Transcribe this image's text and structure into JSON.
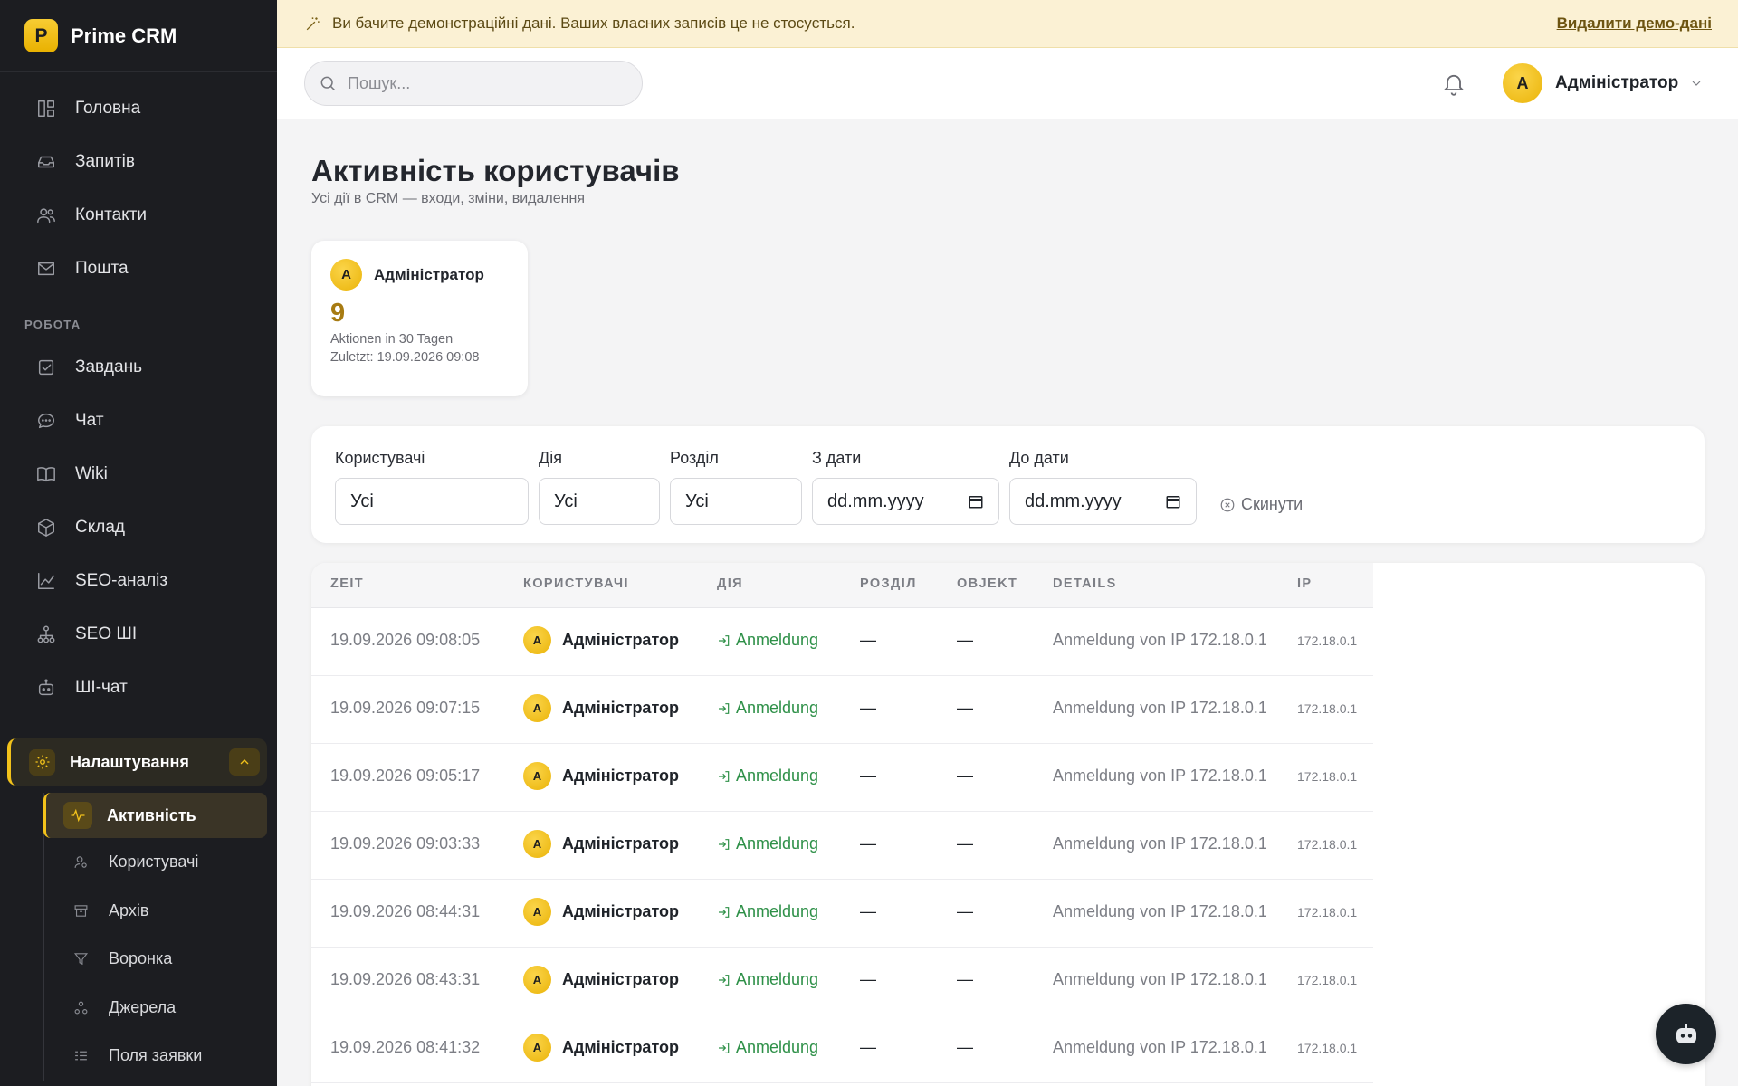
{
  "app": {
    "logo_letter": "P",
    "name": "Prime CRM"
  },
  "sidebar": {
    "items": [
      {
        "label": "Головна",
        "icon": "dashboard-icon"
      },
      {
        "label": "Запитів",
        "icon": "inbox-icon"
      },
      {
        "label": "Контакти",
        "icon": "contacts-icon"
      },
      {
        "label": "Пошта",
        "icon": "mail-icon"
      }
    ],
    "section_label": "РОБОТА",
    "work_items": [
      {
        "label": "Завдань",
        "icon": "tasks-icon"
      },
      {
        "label": "Чат",
        "icon": "chat-icon"
      },
      {
        "label": "Wiki",
        "icon": "book-icon"
      },
      {
        "label": "Склад",
        "icon": "box-icon"
      },
      {
        "label": "SEO-аналіз",
        "icon": "chart-icon"
      },
      {
        "label": "SEO ШІ",
        "icon": "hierarchy-icon"
      },
      {
        "label": "ШІ-чат",
        "icon": "robot-icon"
      }
    ],
    "settings_label": "Налаштування",
    "active_sub": "Активність",
    "sub_items": [
      {
        "label": "Користувачі",
        "icon": "users-icon"
      },
      {
        "label": "Архів",
        "icon": "archive-icon"
      },
      {
        "label": "Воронка",
        "icon": "funnel-icon"
      },
      {
        "label": "Джерела",
        "icon": "sources-icon"
      },
      {
        "label": "Поля заявки",
        "icon": "fields-icon"
      }
    ]
  },
  "banner": {
    "message": "Ви бачите демонстраційні дані. Ваших власних записів це не стосується.",
    "link": "Видалити демо-дані"
  },
  "topbar": {
    "search_placeholder": "Пошук...",
    "user_initial": "А",
    "user_name": "Адміністратор"
  },
  "page": {
    "title": "Активність користувачів",
    "subtitle": "Усі дії в CRM — входи, зміни, видалення"
  },
  "stat_card": {
    "initial": "А",
    "name": "Адміністратор",
    "count": "9",
    "line1": "Aktionen in 30 Tagen",
    "line2": "Zuletzt: 19.09.2026 09:08"
  },
  "filters": {
    "user_label": "Користувачі",
    "user_value": "Усі",
    "action_label": "Дія",
    "action_value": "Усі",
    "section_label": "Розділ",
    "section_value": "Усі",
    "from_label": "З дати",
    "from_value": "dd.mm.yyyy",
    "to_label": "До дати",
    "to_value": "dd.mm.yyyy",
    "reset_label": "Скинути"
  },
  "table": {
    "columns": [
      "ZEIT",
      "КОРИСТУВАЧІ",
      "ДІЯ",
      "РОЗДІЛ",
      "OBJEKT",
      "DETAILS",
      "IP"
    ],
    "rows": [
      {
        "time": "19.09.2026 09:08:05",
        "initial": "А",
        "user": "Адміністратор",
        "action": "Anmeldung",
        "section": "—",
        "object": "—",
        "details": "Anmeldung von IP 172.18.0.1",
        "ip": "172.18.0.1"
      },
      {
        "time": "19.09.2026 09:07:15",
        "initial": "А",
        "user": "Адміністратор",
        "action": "Anmeldung",
        "section": "—",
        "object": "—",
        "details": "Anmeldung von IP 172.18.0.1",
        "ip": "172.18.0.1"
      },
      {
        "time": "19.09.2026 09:05:17",
        "initial": "А",
        "user": "Адміністратор",
        "action": "Anmeldung",
        "section": "—",
        "object": "—",
        "details": "Anmeldung von IP 172.18.0.1",
        "ip": "172.18.0.1"
      },
      {
        "time": "19.09.2026 09:03:33",
        "initial": "А",
        "user": "Адміністратор",
        "action": "Anmeldung",
        "section": "—",
        "object": "—",
        "details": "Anmeldung von IP 172.18.0.1",
        "ip": "172.18.0.1"
      },
      {
        "time": "19.09.2026 08:44:31",
        "initial": "А",
        "user": "Адміністратор",
        "action": "Anmeldung",
        "section": "—",
        "object": "—",
        "details": "Anmeldung von IP 172.18.0.1",
        "ip": "172.18.0.1"
      },
      {
        "time": "19.09.2026 08:43:31",
        "initial": "А",
        "user": "Адміністратор",
        "action": "Anmeldung",
        "section": "—",
        "object": "—",
        "details": "Anmeldung von IP 172.18.0.1",
        "ip": "172.18.0.1"
      },
      {
        "time": "19.09.2026 08:41:32",
        "initial": "А",
        "user": "Адміністратор",
        "action": "Anmeldung",
        "section": "—",
        "object": "—",
        "details": "Anmeldung von IP 172.18.0.1",
        "ip": "172.18.0.1"
      }
    ]
  },
  "colors": {
    "accent": "#f2c21b",
    "sidebar_bg": "#1c1d21",
    "action_green": "#2e9048"
  }
}
